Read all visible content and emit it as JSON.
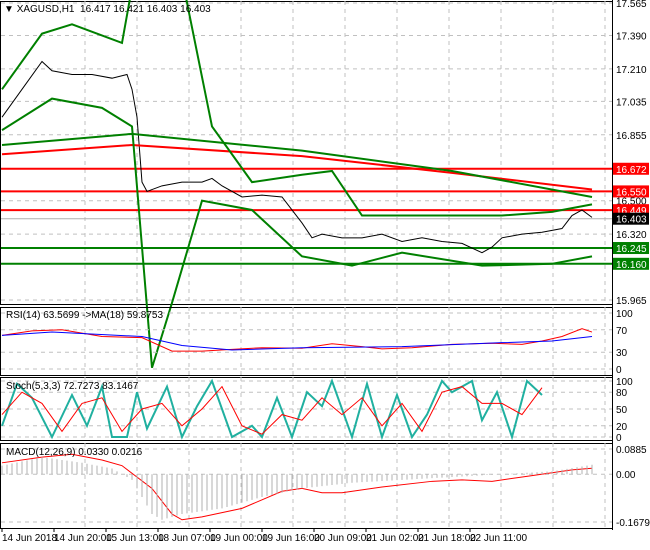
{
  "header": {
    "symbol": "XAGUSD,H1",
    "ohlc": "16.417 16.421 16.403 16.403"
  },
  "chart_data": [
    {
      "type": "line",
      "title": "XAGUSD,H1",
      "ylim": [
        15.965,
        17.565
      ],
      "yticks": [
        "17.565",
        "17.390",
        "17.210",
        "17.035",
        "16.855",
        "16.500",
        "16.320",
        "15.965"
      ],
      "xticks": [
        "14 Jun 2018",
        "14 Jun 20:00",
        "15 Jun 13:00",
        "18 Jun 07:00",
        "19 Jun 00:00",
        "19 Jun 16:00",
        "20 Jun 09:00",
        "21 Jun 02:00",
        "21 Jun 18:00",
        "22 Jun 11:00"
      ],
      "levels": [
        {
          "value": "16.672",
          "color": "#ff0000"
        },
        {
          "value": "16.550",
          "color": "#ff0000"
        },
        {
          "value": "16.449",
          "color": "#ff0000"
        },
        {
          "value": "16.403",
          "color": "#000000"
        },
        {
          "value": "16.245",
          "color": "#008000"
        },
        {
          "value": "16.160",
          "color": "#008000"
        }
      ],
      "series": [
        {
          "name": "price",
          "color": "#000000",
          "points": [
            [
              0,
              16.95
            ],
            [
              4,
              17.1
            ],
            [
              8,
              17.25
            ],
            [
              10,
              17.2
            ],
            [
              14,
              17.18
            ],
            [
              18,
              17.18
            ],
            [
              22,
              17.16
            ],
            [
              25,
              17.18
            ],
            [
              26,
              17.1
            ],
            [
              27,
              16.95
            ],
            [
              28,
              16.6
            ],
            [
              29,
              16.55
            ],
            [
              32,
              16.58
            ],
            [
              36,
              16.6
            ],
            [
              40,
              16.6
            ],
            [
              42,
              16.62
            ],
            [
              44,
              16.58
            ],
            [
              48,
              16.52
            ],
            [
              52,
              16.53
            ],
            [
              56,
              16.52
            ],
            [
              60,
              16.38
            ],
            [
              62,
              16.3
            ],
            [
              64,
              16.32
            ],
            [
              68,
              16.3
            ],
            [
              72,
              16.3
            ],
            [
              76,
              16.32
            ],
            [
              80,
              16.28
            ],
            [
              84,
              16.3
            ],
            [
              88,
              16.28
            ],
            [
              92,
              16.27
            ],
            [
              96,
              16.22
            ],
            [
              98,
              16.25
            ],
            [
              100,
              16.3
            ],
            [
              104,
              16.32
            ],
            [
              108,
              16.33
            ],
            [
              112,
              16.35
            ],
            [
              114,
              16.42
            ],
            [
              116,
              16.45
            ],
            [
              118,
              16.41
            ]
          ]
        },
        {
          "name": "ma-red",
          "color": "#ff0000",
          "points": [
            [
              0,
              16.75
            ],
            [
              26,
              16.8
            ],
            [
              60,
              16.74
            ],
            [
              90,
              16.65
            ],
            [
              118,
              16.56
            ]
          ]
        },
        {
          "name": "ma-green",
          "color": "#008000",
          "points": [
            [
              0,
              16.8
            ],
            [
              26,
              16.86
            ],
            [
              60,
              16.77
            ],
            [
              90,
              16.66
            ],
            [
              118,
              16.52
            ]
          ]
        },
        {
          "name": "bb-upper",
          "color": "#008000",
          "points": [
            [
              0,
              17.1
            ],
            [
              8,
              17.4
            ],
            [
              14,
              17.45
            ],
            [
              24,
              17.35
            ],
            [
              27,
              17.8
            ],
            [
              36,
              17.7
            ],
            [
              42,
              16.9
            ],
            [
              50,
              16.6
            ],
            [
              60,
              16.64
            ],
            [
              66,
              16.66
            ],
            [
              72,
              16.42
            ],
            [
              90,
              16.42
            ],
            [
              100,
              16.42
            ],
            [
              110,
              16.44
            ],
            [
              118,
              16.48
            ]
          ]
        },
        {
          "name": "bb-lower",
          "color": "#008000",
          "points": [
            [
              0,
              16.88
            ],
            [
              10,
              17.05
            ],
            [
              20,
              17.0
            ],
            [
              26,
              16.9
            ],
            [
              30,
              15.6
            ],
            [
              34,
              15.95
            ],
            [
              40,
              16.5
            ],
            [
              50,
              16.45
            ],
            [
              60,
              16.2
            ],
            [
              70,
              16.15
            ],
            [
              80,
              16.22
            ],
            [
              96,
              16.15
            ],
            [
              110,
              16.16
            ],
            [
              118,
              16.2
            ]
          ]
        }
      ]
    },
    {
      "type": "line",
      "title": "RSI(14) 63.5699  ->MA(18) 59.8753",
      "ylim": [
        0,
        100
      ],
      "yticks": [
        "100",
        "70",
        "30",
        "0"
      ],
      "series": [
        {
          "name": "RSI",
          "color": "#ff0000",
          "points": [
            [
              0,
              60
            ],
            [
              6,
              68
            ],
            [
              12,
              70
            ],
            [
              20,
              58
            ],
            [
              28,
              56
            ],
            [
              34,
              32
            ],
            [
              40,
              32
            ],
            [
              46,
              35
            ],
            [
              52,
              38
            ],
            [
              60,
              37
            ],
            [
              66,
              45
            ],
            [
              72,
              40
            ],
            [
              76,
              36
            ],
            [
              82,
              38
            ],
            [
              90,
              44
            ],
            [
              98,
              46
            ],
            [
              104,
              44
            ],
            [
              108,
              50
            ],
            [
              112,
              58
            ],
            [
              116,
              72
            ],
            [
              118,
              66
            ]
          ]
        },
        {
          "name": "MA",
          "color": "#0000ff",
          "points": [
            [
              0,
              60
            ],
            [
              10,
              66
            ],
            [
              28,
              58
            ],
            [
              36,
              42
            ],
            [
              46,
              34
            ],
            [
              60,
              38
            ],
            [
              80,
              40
            ],
            [
              100,
              47
            ],
            [
              110,
              50
            ],
            [
              118,
              58
            ]
          ]
        }
      ]
    },
    {
      "type": "line",
      "title": "Stoch(5,3,3) 72.7273 83.1467",
      "ylim": [
        0,
        100
      ],
      "yticks": [
        "100",
        "80",
        "50",
        "20",
        "0"
      ],
      "series": [
        {
          "name": "main",
          "color": "#20b0a0",
          "points": [
            [
              0,
              20
            ],
            [
              3,
              95
            ],
            [
              6,
              70
            ],
            [
              10,
              0
            ],
            [
              14,
              75
            ],
            [
              17,
              20
            ],
            [
              20,
              90
            ],
            [
              22,
              0
            ],
            [
              25,
              0
            ],
            [
              27,
              80
            ],
            [
              29,
              15
            ],
            [
              33,
              90
            ],
            [
              36,
              0
            ],
            [
              39,
              55
            ],
            [
              42,
              100
            ],
            [
              46,
              0
            ],
            [
              50,
              20
            ],
            [
              52,
              0
            ],
            [
              55,
              70
            ],
            [
              58,
              0
            ],
            [
              61,
              80
            ],
            [
              64,
              55
            ],
            [
              66,
              100
            ],
            [
              70,
              0
            ],
            [
              73,
              95
            ],
            [
              76,
              0
            ],
            [
              79,
              75
            ],
            [
              82,
              0
            ],
            [
              85,
              40
            ],
            [
              88,
              100
            ],
            [
              90,
              80
            ],
            [
              94,
              100
            ],
            [
              96,
              30
            ],
            [
              99,
              80
            ],
            [
              102,
              0
            ],
            [
              105,
              100
            ],
            [
              108,
              75
            ]
          ]
        },
        {
          "name": "signal",
          "color": "#ff0000",
          "points": [
            [
              0,
              40
            ],
            [
              4,
              80
            ],
            [
              8,
              60
            ],
            [
              12,
              10
            ],
            [
              16,
              60
            ],
            [
              20,
              70
            ],
            [
              24,
              10
            ],
            [
              28,
              50
            ],
            [
              32,
              60
            ],
            [
              36,
              20
            ],
            [
              40,
              50
            ],
            [
              44,
              90
            ],
            [
              48,
              20
            ],
            [
              52,
              5
            ],
            [
              56,
              40
            ],
            [
              60,
              30
            ],
            [
              64,
              70
            ],
            [
              68,
              40
            ],
            [
              72,
              70
            ],
            [
              76,
              20
            ],
            [
              80,
              60
            ],
            [
              84,
              10
            ],
            [
              88,
              80
            ],
            [
              92,
              90
            ],
            [
              96,
              60
            ],
            [
              100,
              60
            ],
            [
              104,
              40
            ],
            [
              108,
              88
            ]
          ]
        }
      ]
    },
    {
      "type": "line",
      "title": "MACD(12,26,9) 0.0330 0.0216",
      "ylim": [
        -0.1679,
        0.0885
      ],
      "yticks": [
        "0.0885",
        "0.00",
        "-0.1679"
      ],
      "series": [
        {
          "name": "signal",
          "color": "#ff0000",
          "points": [
            [
              0,
              0.04
            ],
            [
              8,
              0.06
            ],
            [
              14,
              0.07
            ],
            [
              20,
              0.05
            ],
            [
              24,
              0.03
            ],
            [
              30,
              -0.05
            ],
            [
              34,
              -0.14
            ],
            [
              36,
              -0.16
            ],
            [
              40,
              -0.15
            ],
            [
              48,
              -0.12
            ],
            [
              56,
              -0.06
            ],
            [
              60,
              -0.05
            ],
            [
              64,
              -0.065
            ],
            [
              68,
              -0.065
            ],
            [
              76,
              -0.045
            ],
            [
              86,
              -0.025
            ],
            [
              92,
              -0.02
            ],
            [
              98,
              -0.025
            ],
            [
              106,
              -0.005
            ],
            [
              114,
              0.015
            ],
            [
              118,
              0.021
            ]
          ]
        },
        {
          "name": "histogram",
          "color": "#b0b0b0",
          "points": [
            [
              0,
              0.03
            ],
            [
              8,
              0.06
            ],
            [
              16,
              0.04
            ],
            [
              22,
              0.02
            ],
            [
              26,
              -0.02
            ],
            [
              30,
              -0.14
            ],
            [
              32,
              -0.16
            ],
            [
              36,
              -0.14
            ],
            [
              44,
              -0.12
            ],
            [
              52,
              -0.08
            ],
            [
              60,
              -0.05
            ],
            [
              70,
              -0.03
            ],
            [
              80,
              -0.02
            ],
            [
              90,
              -0.01
            ],
            [
              100,
              0.0
            ],
            [
              110,
              0.01
            ],
            [
              118,
              0.033
            ]
          ]
        }
      ]
    }
  ]
}
